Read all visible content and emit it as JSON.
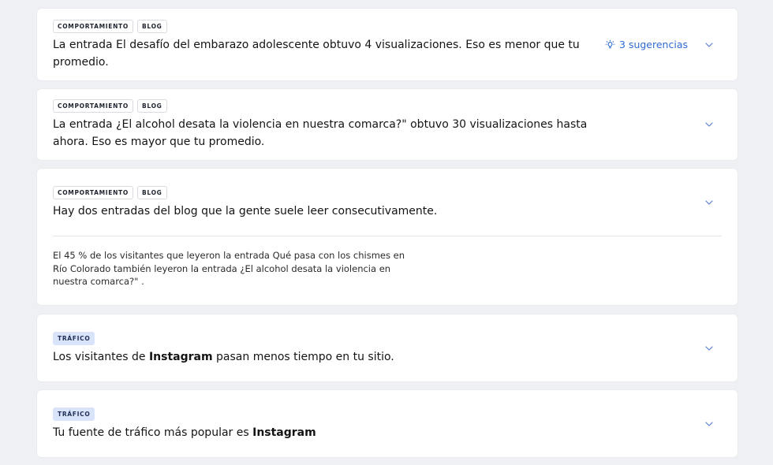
{
  "insights": [
    {
      "tags": [
        "COMPORTAMIENTO",
        "BLOG"
      ],
      "title": "La entrada El desafío del embarazo adolescente obtuvo 4 visualizaciones. Eso es menor que tu promedio.",
      "suggestions_label": "3 sugerencias"
    },
    {
      "tags": [
        "COMPORTAMIENTO",
        "BLOG"
      ],
      "title": "La entrada ¿El alcohol desata la violencia en nuestra comarca?\" obtuvo 30 visualizaciones hasta ahora. Eso es mayor que tu promedio."
    },
    {
      "tags": [
        "COMPORTAMIENTO",
        "BLOG"
      ],
      "title": "Hay dos entradas del blog que la gente suele leer consecutivamente.",
      "detail": "El 45 % de los visitantes que leyeron la entrada Qué pasa con los chismes en Río Colorado también leyeron la entrada ¿El alcohol desata la violencia en nuestra comarca?\" ."
    },
    {
      "tags": [
        "TRÁFICO"
      ],
      "title_before": "Los visitantes de ",
      "title_bold": "Instagram",
      "title_after": " pasan menos tiempo en tu sitio."
    },
    {
      "tags": [
        "TRÁFICO"
      ],
      "title_before": "Tu fuente de tráfico más popular es ",
      "title_bold": "Instagram"
    }
  ],
  "icons": {
    "suggestions": "lightbulb-icon",
    "expand": "chevron-down-icon"
  },
  "colors": {
    "background": "#eef0f4",
    "link": "#2f6bd6",
    "traffic_tag": "#d9e4fb"
  }
}
